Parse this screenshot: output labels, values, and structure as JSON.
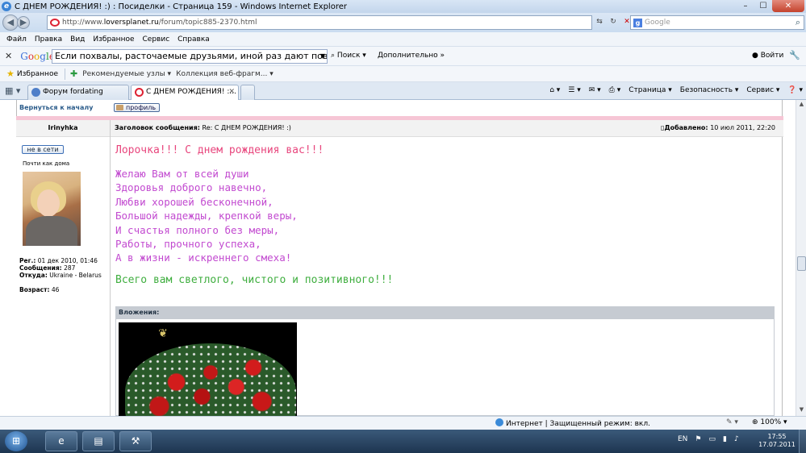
{
  "window": {
    "title": "С ДНЕМ РОЖДЕНИЯ! :) : Посиделки - Страница 159 - Windows Internet Explorer",
    "min": "–",
    "max": "☐",
    "close": "✕"
  },
  "address": {
    "url_prefix": "http://www.",
    "url_domain": "loversplanet.ru",
    "url_path": "/forum/topic885-2370.html",
    "search_placeholder": "Google"
  },
  "menu": [
    "Файл",
    "Правка",
    "Вид",
    "Избранное",
    "Сервис",
    "Справка"
  ],
  "google_toolbar": {
    "logo": [
      "G",
      "o",
      "o",
      "g",
      "l",
      "e"
    ],
    "query": "Если похвалы, расточаемые друзьями, иной раз дают повод у",
    "search_label": "Поиск",
    "more_label": "Дополнительно »",
    "login_label": "Войти"
  },
  "favorites_bar": {
    "favorites_label": "Избранное",
    "items": [
      "Рекомендуемые узлы ▾",
      "Коллекция веб-фрагм... ▾"
    ]
  },
  "tabs": [
    {
      "label": "Форум fordating",
      "active": false
    },
    {
      "label": "С ДНЕМ РОЖДЕНИЯ! :...",
      "active": true
    }
  ],
  "command_bar": [
    "Страница ▾",
    "Безопасность ▾",
    "Сервис ▾"
  ],
  "forum": {
    "back_link": "Вернуться к началу",
    "profile_button": "профиль",
    "author": "Irinyhka",
    "subject_label": "Заголовок сообщения:",
    "subject": "Re: С ДНЕМ РОЖДЕНИЯ! :)",
    "added_label": "Добавлено:",
    "added_date": "10 июл 2011, 22:20",
    "status_button": "не в сети",
    "rank": "Почти как дома",
    "stats": {
      "reg_label": "Рег.:",
      "reg_value": "01 дек 2010, 01:46",
      "posts_label": "Сообщения:",
      "posts_value": "287",
      "from_label": "Откуда:",
      "from_value": "Ukraine - Belarus",
      "age_label": "Возраст:",
      "age_value": "46"
    },
    "message": {
      "line1": "Лорочка!!! С днем рождения вас!!!",
      "poem": [
        "Желаю Вам от всей души",
        "Здоровья доброго навечно,",
        "Любви хорошей бесконечной,",
        "Большой надежды, крепкой веры,",
        "И счастья полного без меры,",
        "Работы, прочного успеха,",
        "А в жизни - искреннего смеха!"
      ],
      "line2": "Всего вам светлого, чистого и позитивного!!!"
    },
    "attachments_label": "Вложения:"
  },
  "statusbar": {
    "zone": "Интернет | Защищенный режим: вкл.",
    "zoom": "100%"
  },
  "taskbar": {
    "lang": "EN",
    "time": "17:55",
    "date": "17.07.2011"
  },
  "colors": {
    "greeting": "#e8467d",
    "poem": "#c24ad0",
    "wish": "#3fae3f",
    "pink_divider": "#f6c6d5"
  }
}
